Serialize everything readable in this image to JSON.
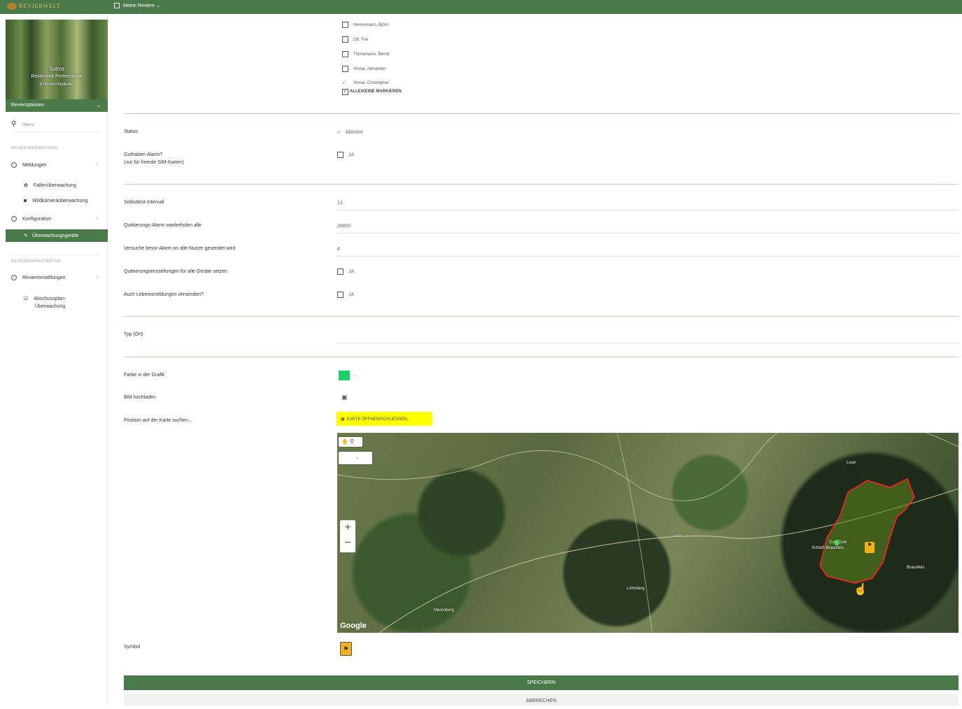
{
  "topbar": {
    "brand": "REVIERWELT",
    "reviere": "Meine Reviere ⌄"
  },
  "sidebar": {
    "banner": {
      "name": "Solms",
      "plan": "Revierwelt Professional",
      "members": "8 Reviermitglieder"
    },
    "revieroptionen": "Revieroptionen",
    "search": "Übersi",
    "section1": "REVIERÜBERWACHUNG",
    "meldungen": "Meldungen",
    "fallen": "Fallenüberwachung",
    "wildkamera": "Wildkameraüberwachung",
    "konfiguration": "Konfiguration",
    "ueberwachungsgeraete": "Überwachungsgeräte",
    "section2": "REVIERADMINISTRATION",
    "reviereinstellungen": "Reviereinstellungen",
    "abschussplan": "Abschussplan-",
    "abschussplan2": "Überwachung"
  },
  "users": [
    "Hennemann, Björn",
    "Ott, Fex",
    "Thünemann, Bernd",
    "Vinnai, Alexander",
    "Vinnai, Christopher"
  ],
  "select_all": "ALLE/KEINE MARKIEREN",
  "fields": {
    "status_label": "Status",
    "status_value": "Aktiviert",
    "guthaben_label": "Guthaben-Alarm?",
    "guthaben_sub": "(nur für fremde SIM-Karten)",
    "ja": "JA",
    "selbsttest_label": "Selbsttest-Intervall",
    "selbsttest_value": "12",
    "quitt_label": "Quittierungs-Alarm wiederholen alle",
    "quitt_value": "28800",
    "versuche_label": "Versuche bevor Alarm an alle Nutzer gesendet wird",
    "versuche_value": "4",
    "quitt_all_label": "Quittierungseinstellungen für alle Geräte setzen",
    "leben_label": "Auch Lebensmeldungen versenden?",
    "typ_label": "Typ (Ort)",
    "farbe_label": "Farbe in der Grafik",
    "farbe_value": "#1bd068",
    "bild_label": "Bild hochladen",
    "position_label": "Position auf der Karte suchen...",
    "map_button": "KARTE ÖFFNEN/SCHLIESSEN...",
    "symbol_label": "Symbol"
  },
  "map": {
    "towns": [
      "Leun",
      "Lenn",
      "Golf Club",
      "Schloß Braunfels",
      "Braunfels",
      "Löhnberg",
      "Merenberg"
    ],
    "brand": "Google",
    "zoom_in": "+",
    "zoom_out": "−"
  },
  "actions": {
    "save": "SPEICHERN",
    "cancel": "ABBRECHEN"
  }
}
